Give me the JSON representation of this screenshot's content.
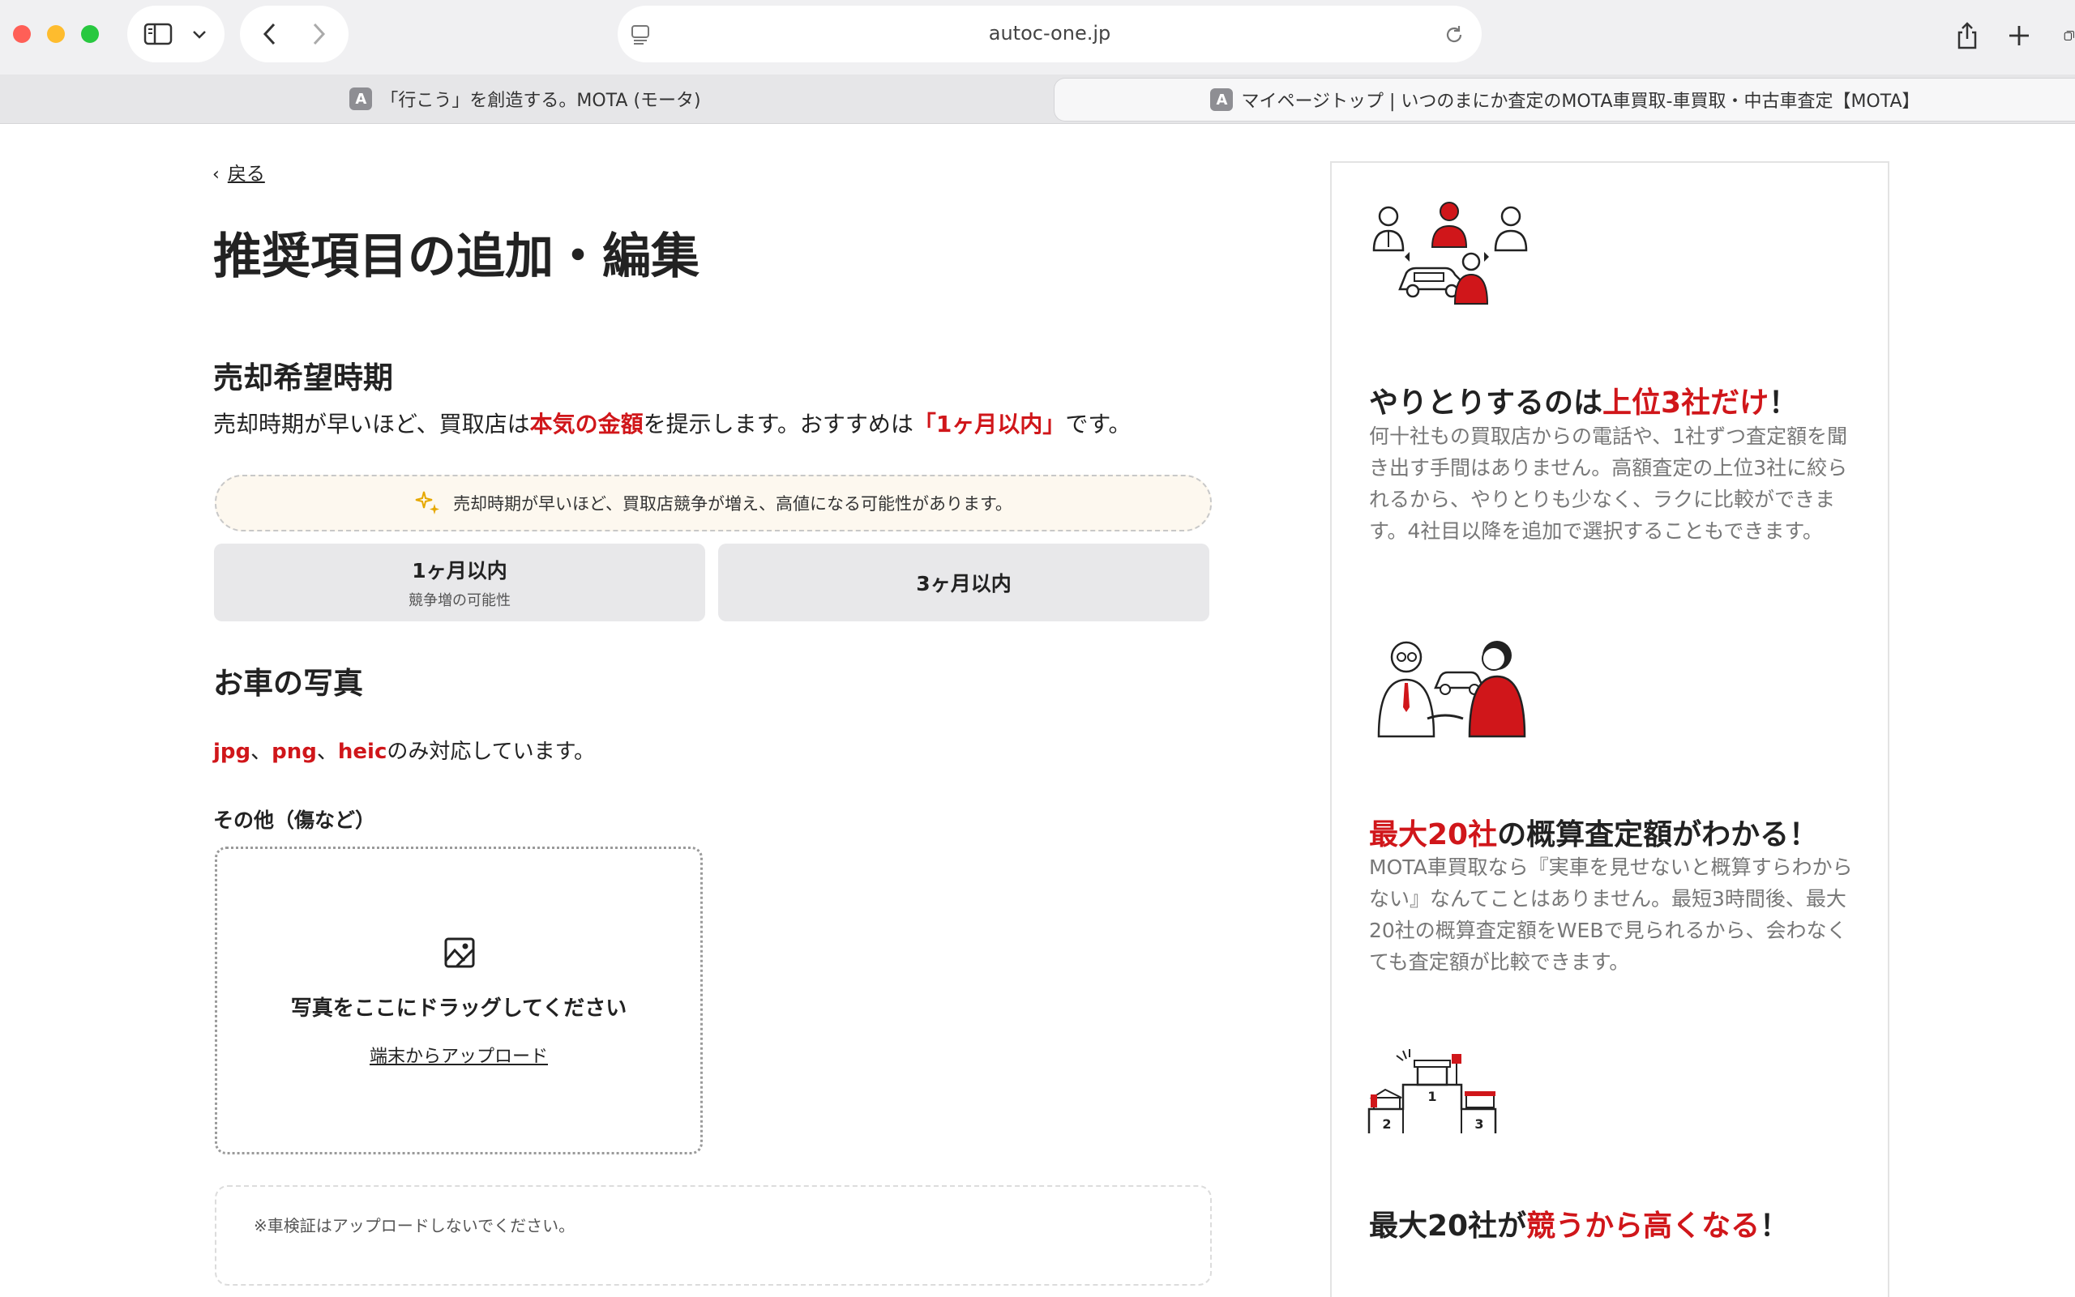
{
  "browser": {
    "url": "autoc-one.jp",
    "tabs": [
      {
        "favicon": "A",
        "title": "「行こう」を創造する。MOTA (モータ)"
      },
      {
        "favicon": "A",
        "title": "マイページトップ | いつのまにか査定のMOTA車買取-車買取・中古車査定【MOTA】"
      }
    ]
  },
  "page": {
    "back_label": "戻る",
    "title": "推奨項目の追加・編集"
  },
  "sale_timing": {
    "heading": "売却希望時期",
    "desc_part1": "売却時期が早いほど、買取店は",
    "desc_highlight1": "本気の金額",
    "desc_part2": "を提示します。おすすめは",
    "desc_highlight2": "「1ヶ月以内」",
    "desc_part3": "です。",
    "hint": "売却時期が早いほど、買取店競争が増え、高値になる可能性があります。",
    "options": [
      {
        "label": "1ヶ月以内",
        "sub": "競争増の可能性"
      },
      {
        "label": "3ヶ月以内",
        "sub": ""
      }
    ]
  },
  "photos": {
    "heading": "お車の写真",
    "fmt1": "jpg",
    "sep1": "、",
    "fmt2": "png",
    "sep2": "、",
    "fmt3": "heic",
    "fmt_suffix": "のみ対応しています。",
    "other_label": "その他（傷など）",
    "drag_text": "写真をここにドラッグしてください",
    "upload_link": "端末からアップロード",
    "note": "※車検証はアップロードしないでください。"
  },
  "sidebar": {
    "feature1": {
      "title_pre": "やりとりするのは",
      "title_hl": "上位3社だけ",
      "title_post": "！",
      "body": "何十社もの買取店からの電話や、1社ずつ査定額を聞き出す手間はありません。高額査定の上位3社に絞られるから、やりとりも少なく、ラクに比較ができます。4社目以降を追加で選択することもできます。"
    },
    "feature2": {
      "title_hl": "最大20社",
      "title_post": "の概算査定額がわかる！",
      "body": "MOTA車買取なら『実車を見せないと概算すらわからない』なんてことはありません。最短3時間後、最大20社の概算査定額をWEBで見られるから、会わなくても査定額が比較できます。"
    },
    "feature3": {
      "title_pre": "最大20社が",
      "title_hl": "競うから高くなる",
      "title_post": "！",
      "podium": {
        "first": "1",
        "second": "2",
        "third": "3"
      }
    }
  },
  "colors": {
    "accent": "#d0161a",
    "hint_bg": "#fdf8ef",
    "option_bg": "#e8e8ea",
    "body_text": "#777777"
  }
}
